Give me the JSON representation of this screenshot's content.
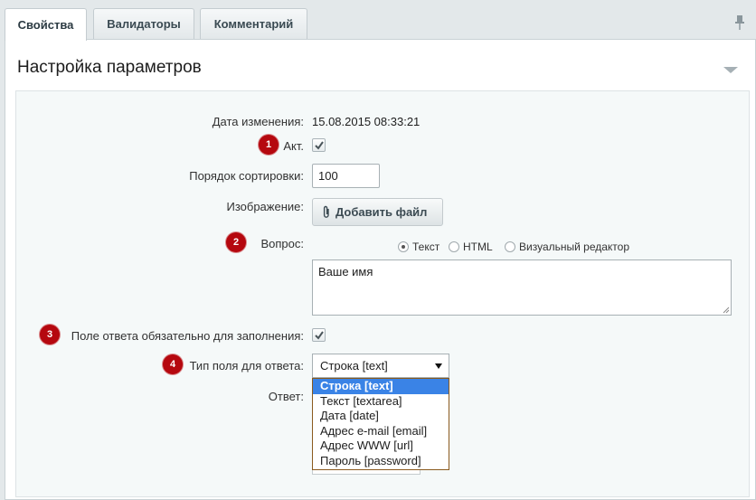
{
  "tabs": [
    {
      "label": "Свойства",
      "active": true
    },
    {
      "label": "Валидаторы",
      "active": false
    },
    {
      "label": "Комментарий",
      "active": false
    }
  ],
  "section": {
    "title": "Настройка параметров"
  },
  "form": {
    "date_label": "Дата изменения:",
    "date_value": "15.08.2015 08:33:21",
    "active_label": "Акт.",
    "active_checked": true,
    "sort_label": "Порядок сортировки:",
    "sort_value": "100",
    "image_label": "Изображение:",
    "add_file_label": "Добавить файл",
    "question_label": "Вопрос:",
    "question_modes": [
      {
        "label": "Текст",
        "selected": true
      },
      {
        "label": "HTML",
        "selected": false
      },
      {
        "label": "Визуальный редактор",
        "selected": false
      }
    ],
    "question_text": "Ваше имя",
    "required_label": "Поле ответа обязательно для заполнения:",
    "required_checked": true,
    "field_type_label": "Тип поля для ответа:",
    "field_type_value": "Строка [text]",
    "field_type_options": [
      "Строка [text]",
      "Текст [textarea]",
      "Дата [date]",
      "Адрес e-mail [email]",
      "Адрес WWW [url]",
      "Пароль [password]"
    ],
    "answer_label": "Ответ:"
  },
  "badges": [
    "1",
    "2",
    "3",
    "4"
  ],
  "colors": {
    "badge": "#b5080f",
    "highlight": "#3a83e6"
  }
}
